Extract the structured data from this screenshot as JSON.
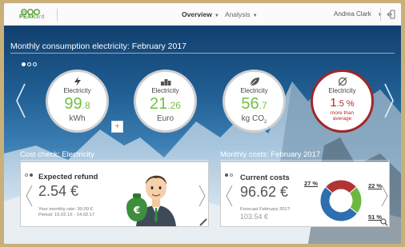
{
  "header": {
    "logo_text": "PEAK",
    "logo_suffix": "ard",
    "nav": [
      {
        "label": "Overview",
        "active": true
      },
      {
        "label": "Analysis",
        "active": false
      }
    ],
    "user_name": "Andrea Clark"
  },
  "monthly": {
    "title": "Monthly consumption electricity: February 2017",
    "tiles": [
      {
        "label": "Electricity",
        "value_main": "99",
        "value_dec": ".8",
        "unit": "kWh",
        "icon": "lightning-icon"
      },
      {
        "label": "Electricity",
        "value_main": "21",
        "value_dec": ".26",
        "unit": "Euro",
        "icon": "coins-icon"
      },
      {
        "label": "Electricity",
        "value_main": "56",
        "value_dec": ".7",
        "unit": "kg CO",
        "unit_sub": "2",
        "icon": "leaf-icon"
      },
      {
        "label": "Electricity",
        "value_main": "1",
        "value_dec": ".5 %",
        "unit": "more than average",
        "icon": "average-icon"
      }
    ]
  },
  "cost_check": {
    "section_title": "Cost check: Electricity",
    "card_title": "Expected refund",
    "amount": "2.54 €",
    "rate_line": "Your monthly rate: 30.00 €",
    "period_line": "Period: 15.02.16 - 14.02.17"
  },
  "monthly_costs": {
    "section_title": "Monthly costs: February 2017",
    "card_title": "Current costs",
    "amount": "96.62 €",
    "forecast_label": "Forecast February 2017:",
    "forecast_value": "103.54 €"
  },
  "chart_data": {
    "type": "pie",
    "values": [
      27,
      22,
      51
    ],
    "labels": [
      "27 %",
      "22 %",
      "51 %"
    ],
    "colors": [
      "#b33434",
      "#6cb83e",
      "#2d6fb0"
    ]
  }
}
